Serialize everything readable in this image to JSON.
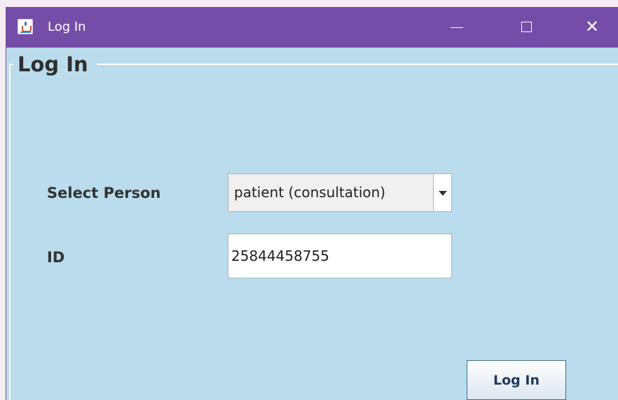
{
  "window": {
    "title": "Log In",
    "titlebar_color": "#744da8",
    "background_color": "#badcec",
    "icon": "java-cup-icon",
    "controls": {
      "minimize_glyph": "—",
      "maximize_glyph": "☐",
      "close_glyph": "✕"
    }
  },
  "form": {
    "group_title": "Log In",
    "select_person_label": "Select Person",
    "person_combo": {
      "selected": "patient (consultation)",
      "arrow_icon": "chevron-down-icon"
    },
    "id_label": "ID",
    "id_value": "25844458755",
    "login_button": "Log In"
  }
}
